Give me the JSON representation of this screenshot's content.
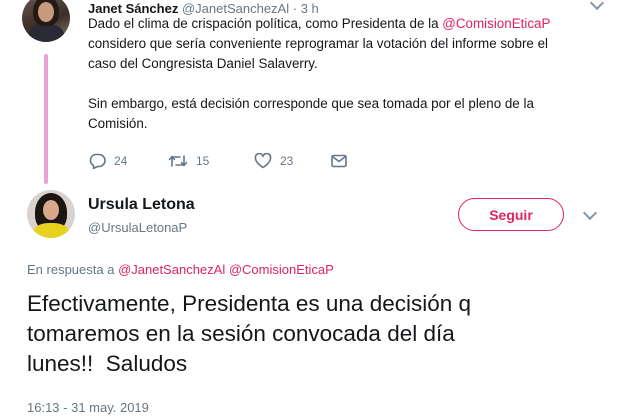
{
  "parent_tweet": {
    "author_name": "Janet Sánchez",
    "author_handle": "@JanetSanchezAl",
    "separator": "·",
    "time": "3 h",
    "line1_prefix": "Dado el clima de crispación política, como Presidenta de la ",
    "line1_mention": "@ComisionEticaP",
    "line2": "considero que sería conveniente reprogramar la votación del informe sobre el",
    "line3": "caso del Congresista Daniel Salaverry.",
    "line4": "Sin embargo, está decisión corresponde que sea tomada por el pleno de la",
    "line5": "Comisión.",
    "reply_count": "24",
    "retweet_count": "15",
    "like_count": "23",
    "icons": [
      "reply-icon",
      "retweet-icon",
      "like-icon",
      "dm-icon",
      "chevron-down-icon"
    ]
  },
  "reply_tweet": {
    "author_name": "Ursula Letona",
    "author_handle": "@UrsulaLetonaP",
    "follow_label": "Seguir",
    "replying_prefix": "En respuesta a ",
    "replying_mention1": "@JanetSanchezAl",
    "replying_mention2": "@ComisionEticaP",
    "text": "Efectivamente, Presidenta es una decisión q\ntomaremos en la sesión convocada del día\nlunes!!  Saludos",
    "timestamp": "16:13 - 31 may. 2019"
  },
  "colors": {
    "accent": "#e0245e",
    "thread_line": "#e6a3d7",
    "muted_text": "#657786",
    "text": "#14171a"
  }
}
